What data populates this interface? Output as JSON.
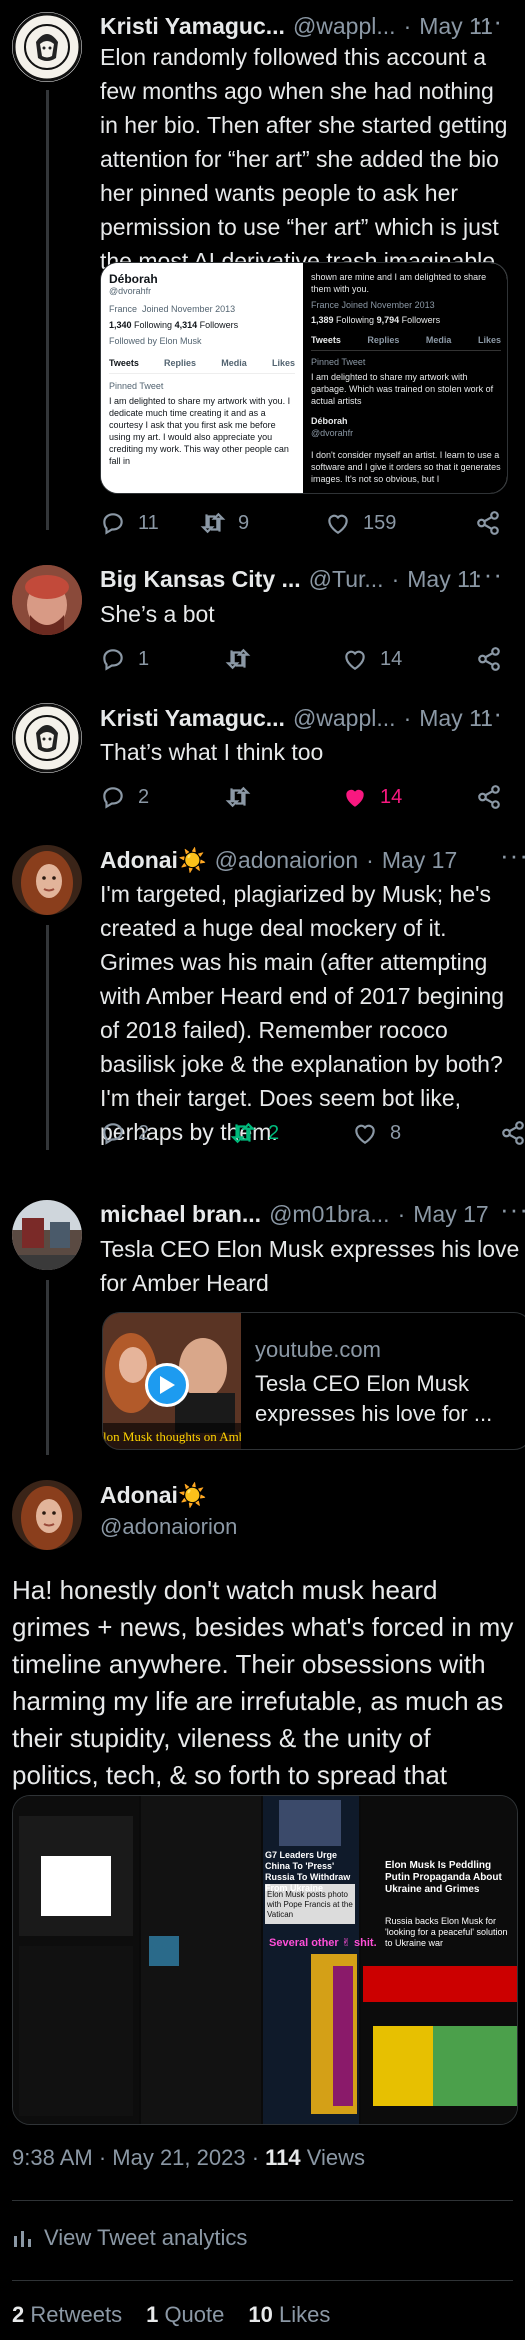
{
  "tweets": [
    {
      "name": "Kristi Yamaguc...",
      "handle": "@wappl...",
      "date": "May 11",
      "text": "Elon randomly followed this account a few months ago when she had nothing in her bio. Then after she started getting attention for “her art” she added the bio her pinned wants people to ask her permission to use “her art” which is just the most AI derivative trash imaginable",
      "replies": "11",
      "retweets": "9",
      "likes": "159"
    },
    {
      "name": "Big Kansas City ...",
      "handle": "@Tur...",
      "date": "May 11",
      "text": "She’s a bot",
      "replies": "1",
      "retweets": "",
      "likes": "14"
    },
    {
      "name": "Kristi Yamaguc...",
      "handle": "@wappl...",
      "date": "May 11",
      "text": "That’s what I think too",
      "replies": "2",
      "retweets": "",
      "likes": "14"
    },
    {
      "name": "Adonai☀️",
      "handle": "@adonaiorion",
      "date": "May 17",
      "text": "I'm targeted, plagiarized by Musk; he's created a huge deal mockery of it. Grimes was his main (after attempting with Amber Heard end of 2017 begining of 2018 failed). Remember rococo basilisk joke & the explanation by both? I'm their target. Does  seem bot like, perhaps by them.",
      "replies": "2",
      "retweets": "2",
      "likes": "8"
    },
    {
      "name": "michael bran...",
      "handle": "@m01bra...",
      "date": "May 17",
      "text": "Tesla CEO Elon Musk expresses his love for Amber Heard",
      "card": {
        "domain": "youtube.com",
        "title": "Tesla CEO Elon Musk expresses his love for ...",
        "thumb_caption": "lon Musk thoughts on Amber He"
      }
    }
  ],
  "embed_screenshot": {
    "left_name": "Déborah",
    "left_handle": "@dvorahfr",
    "left_location": "France",
    "left_joined": "Joined November 2013",
    "left_following": "1,340",
    "left_followers": "4,314",
    "followed_by": "Followed by Elon Musk",
    "tabs": [
      "Tweets",
      "Replies",
      "Media",
      "Likes"
    ],
    "pinned": "Pinned Tweet",
    "left_tweet": "I am delighted to share my artwork with you. I dedicate much time creating it and as a courtesy I ask that you first ask me before using my art. I would also appreciate you crediting my work. This way other people can fall in",
    "right_top": "shown are mine and I am delighted to share them with you.",
    "right_following": "1,389",
    "right_followers": "9,794",
    "right_tweet": "I am delighted to share my artwork with garbage. Which was trained on stolen work of actual artists",
    "right_bottom": "I don't consider myself an artist. I learn to use a software and I give it orders so that it generates images. It's not so obvious, but I"
  },
  "main": {
    "name": "Adonai☀️",
    "handle": "@adonaiorion",
    "text": "Ha! honestly don't watch musk heard grimes + news, besides what's forced in my timeline anywhere. Their obsessions with harming my life are irrefutable, as much as their stupidity, vileness & the unity of politics, tech, & so forth to spread that ugliness. Verified rotten crap.☄️",
    "collage_labels": {
      "g7": "G7 Leaders Urge China To 'Press' Russia To Withdraw From Ukraine",
      "pope": "Elon Musk posts photo with Pope Francis at the Vatican",
      "several": "Several other ✌ shit.",
      "peddling": "Elon Musk Is Peddling Putin Propaganda About Ukraine and Grimes",
      "russia_backs": "Russia backs Elon Musk for 'looking for a peaceful' solution to Ukraine war"
    },
    "timestamp": "9:38 AM · May 21, 2023 · ",
    "views_count": "114",
    "views_label": " Views",
    "analytics_label": "View Tweet analytics",
    "stats": [
      {
        "count": "2",
        "label": " Retweets"
      },
      {
        "count": "1",
        "label": " Quote"
      },
      {
        "count": "10",
        "label": " Likes"
      }
    ]
  },
  "colors": {
    "background": "#000000",
    "text": "#e7e9ea",
    "muted": "#8b98a5",
    "liked": "#f91880",
    "retweeted": "#00ba7c",
    "divider": "#2f3336"
  }
}
